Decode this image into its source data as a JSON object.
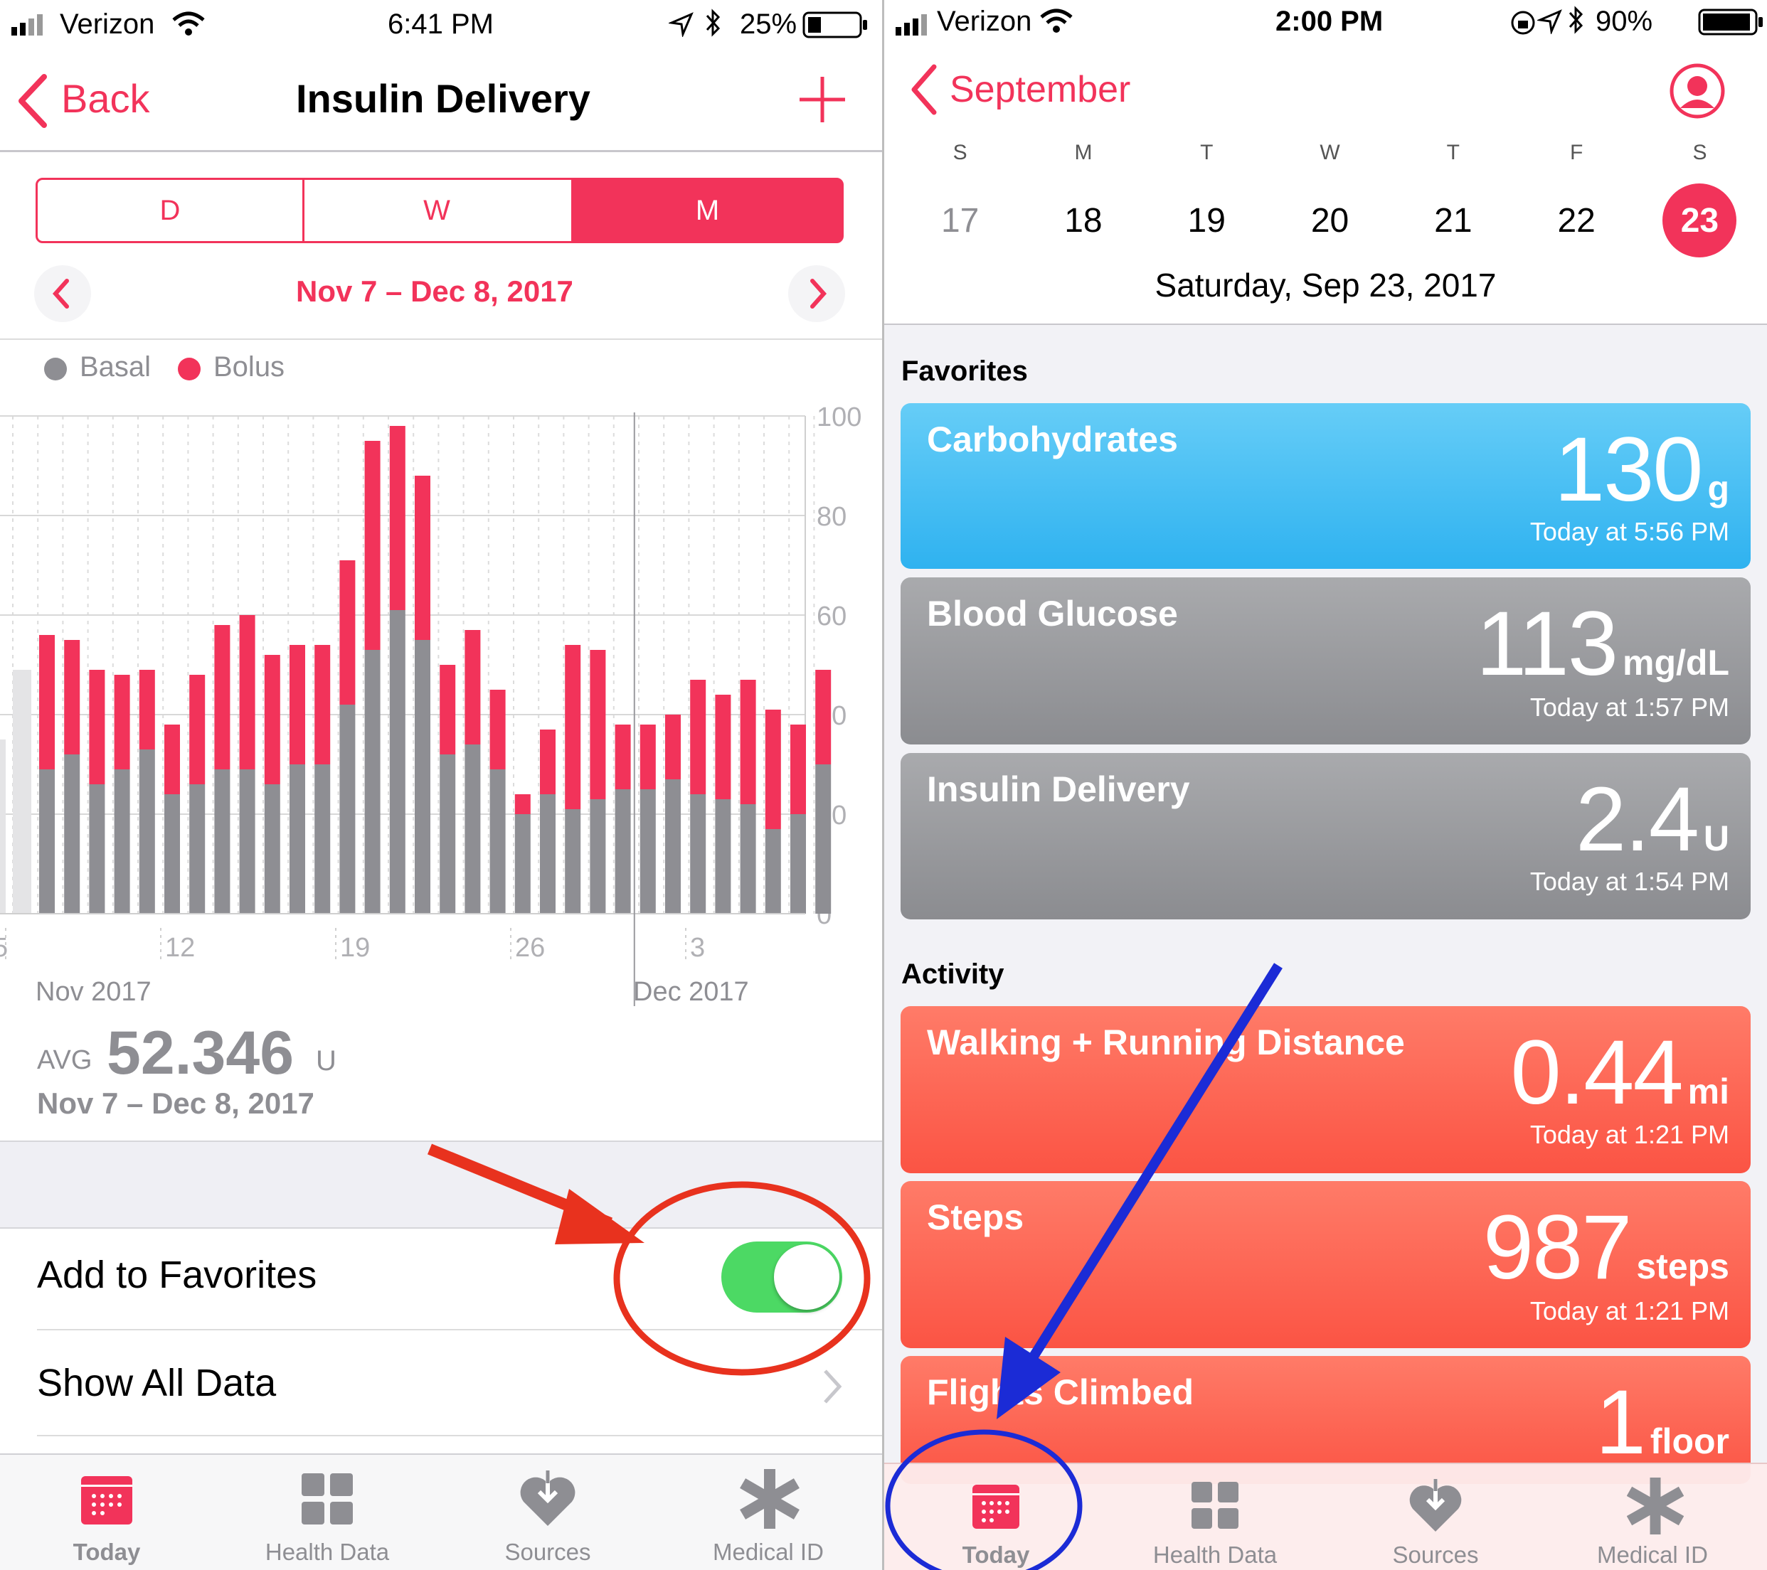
{
  "left": {
    "status": {
      "carrier": "Verizon",
      "time": "6:41 PM",
      "battery": "25%"
    },
    "nav": {
      "back": "Back",
      "title": "Insulin Delivery",
      "add_icon": "plus-icon"
    },
    "segments": [
      "D",
      "W",
      "M"
    ],
    "selected_segment": "M",
    "date_range": "Nov 7 – Dec 8, 2017",
    "legend": [
      {
        "label": "Basal",
        "color": "#8e8e93"
      },
      {
        "label": "Bolus",
        "color": "#f2335a"
      }
    ],
    "x_ticks": [
      "5",
      "12",
      "19",
      "26",
      "3"
    ],
    "month_labels": [
      "Nov 2017",
      "Dec 2017"
    ],
    "avg": {
      "label": "AVG",
      "value": "52.346",
      "unit": "U",
      "range": "Nov 7 – Dec 8, 2017"
    },
    "favorites_label": "Add to Favorites",
    "favorites_on": true,
    "show_all": "Show All Data",
    "tabs": [
      {
        "label": "Today",
        "icon": "calendar-icon",
        "active": true
      },
      {
        "label": "Health Data",
        "icon": "grid-icon",
        "active": false
      },
      {
        "label": "Sources",
        "icon": "heart-download-icon",
        "active": false
      },
      {
        "label": "Medical ID",
        "icon": "asterisk-icon",
        "active": false
      }
    ]
  },
  "chart_data": {
    "type": "bar",
    "stacked": true,
    "ylim": [
      0,
      100
    ],
    "y_ticks": [
      0,
      20,
      40,
      60,
      80,
      100
    ],
    "categories": [
      "Nov 7",
      "Nov 8",
      "Nov 9",
      "Nov 10",
      "Nov 11",
      "Nov 12",
      "Nov 13",
      "Nov 14",
      "Nov 15",
      "Nov 16",
      "Nov 17",
      "Nov 18",
      "Nov 19",
      "Nov 20",
      "Nov 21",
      "Nov 22",
      "Nov 23",
      "Nov 24",
      "Nov 25",
      "Nov 26",
      "Nov 27",
      "Nov 28",
      "Nov 29",
      "Nov 30",
      "Dec 1",
      "Dec 2",
      "Dec 3",
      "Dec 4",
      "Dec 5",
      "Dec 6",
      "Dec 7",
      "Dec 8"
    ],
    "series": [
      {
        "name": "Basal",
        "color": "#8e8e93",
        "values": [
          29,
          32,
          26,
          29,
          33,
          24,
          26,
          29,
          29,
          26,
          30,
          30,
          42,
          53,
          61,
          55,
          32,
          34,
          29,
          20,
          24,
          21,
          23,
          25,
          25,
          27,
          24,
          23,
          22,
          17,
          20,
          30
        ]
      },
      {
        "name": "Bolus",
        "color": "#f2335a",
        "values": [
          27,
          23,
          23,
          19,
          16,
          14,
          22,
          29,
          31,
          26,
          24,
          24,
          29,
          42,
          37,
          33,
          18,
          23,
          16,
          4,
          13,
          33,
          30,
          13,
          13,
          13,
          23,
          21,
          25,
          24,
          18,
          19
        ]
      }
    ]
  },
  "right": {
    "status": {
      "carrier": "Verizon",
      "time": "2:00 PM",
      "battery": "90%"
    },
    "nav": {
      "back": "September",
      "profile_icon": "profile-icon"
    },
    "weekdays": [
      "S",
      "M",
      "T",
      "W",
      "T",
      "F",
      "S"
    ],
    "days": [
      "17",
      "18",
      "19",
      "20",
      "21",
      "22",
      "23"
    ],
    "selected_day": "23",
    "date_title": "Saturday, Sep 23, 2017",
    "sections": {
      "favorites": "Favorites",
      "activity": "Activity"
    },
    "favorites": [
      {
        "title": "Carbohydrates",
        "value": "130",
        "unit": "g",
        "sub": "Today at 5:56 PM"
      },
      {
        "title": "Blood Glucose",
        "value": "113",
        "unit": "mg/dL",
        "sub": "Today at 1:57 PM"
      },
      {
        "title": "Insulin Delivery",
        "value": "2.4",
        "unit": "U",
        "sub": "Today at 1:54 PM"
      }
    ],
    "activity": [
      {
        "title": "Walking + Running Distance",
        "value": "0.44",
        "unit": "mi",
        "sub": "Today at 1:21 PM"
      },
      {
        "title": "Steps",
        "value": "987",
        "unit": "steps",
        "sub": "Today at 1:21 PM"
      },
      {
        "title": "Flights Climbed",
        "value": "1",
        "unit": "floor"
      }
    ],
    "tabs": [
      {
        "label": "Today",
        "icon": "calendar-icon",
        "active": true
      },
      {
        "label": "Health Data",
        "icon": "grid-icon",
        "active": false
      },
      {
        "label": "Sources",
        "icon": "heart-download-icon",
        "active": false
      },
      {
        "label": "Medical ID",
        "icon": "asterisk-icon",
        "active": false
      }
    ]
  },
  "annotations": {
    "red_arrow_color": "#e8321e",
    "blue_arrow_color": "#1b2bd6"
  }
}
